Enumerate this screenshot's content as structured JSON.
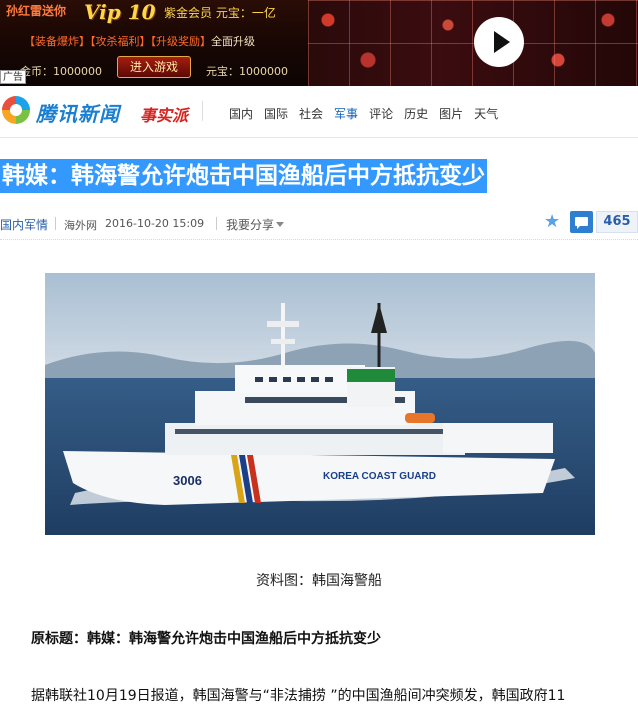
{
  "ad": {
    "row1_left": "孙红雷送你",
    "vip": "Vip 10",
    "row1_right": "紫金会员  元宝：一亿",
    "row2": [
      "【装备爆炸】",
      "【攻杀福利】",
      "【升级奖励】",
      "全面升级"
    ],
    "gold": "金币：1000000",
    "button": "进入游戏",
    "yuanbao": "元宝：1000000",
    "label": "广告",
    "play_icon": "play-icon"
  },
  "header": {
    "logo_text": "腾讯新闻",
    "brand2": "事实派",
    "nav": [
      {
        "label": "国内",
        "active": false
      },
      {
        "label": "国际",
        "active": false
      },
      {
        "label": "社会",
        "active": false
      },
      {
        "label": "军事",
        "active": true
      },
      {
        "label": "评论",
        "active": false
      },
      {
        "label": "历史",
        "active": false
      },
      {
        "label": "图片",
        "active": false
      },
      {
        "label": "天气",
        "active": false
      }
    ]
  },
  "article": {
    "title": "韩媒：韩海警允许炮击中国渔船后中方抵抗变少",
    "category": "国内军情",
    "source": "海外网",
    "time": "2016-10-20 15:09",
    "share": "我要分享",
    "comment_count": "465",
    "image_text": "3006",
    "image_hull_text": "KOREA COAST GUARD",
    "caption": "资料图：韩国海警船",
    "original_title": "原标题：韩媒：韩海警允许炮击中国渔船后中方抵抗变少",
    "first_para": "据韩联社10月19日报道，韩国海警与“非法捕捞 ”的中国渔船间冲突频发，韩国政府11"
  },
  "colors": {
    "title_highlight": "#3399ff",
    "nav_active": "#0f63b7",
    "comment_button": "#2f7fd0"
  }
}
